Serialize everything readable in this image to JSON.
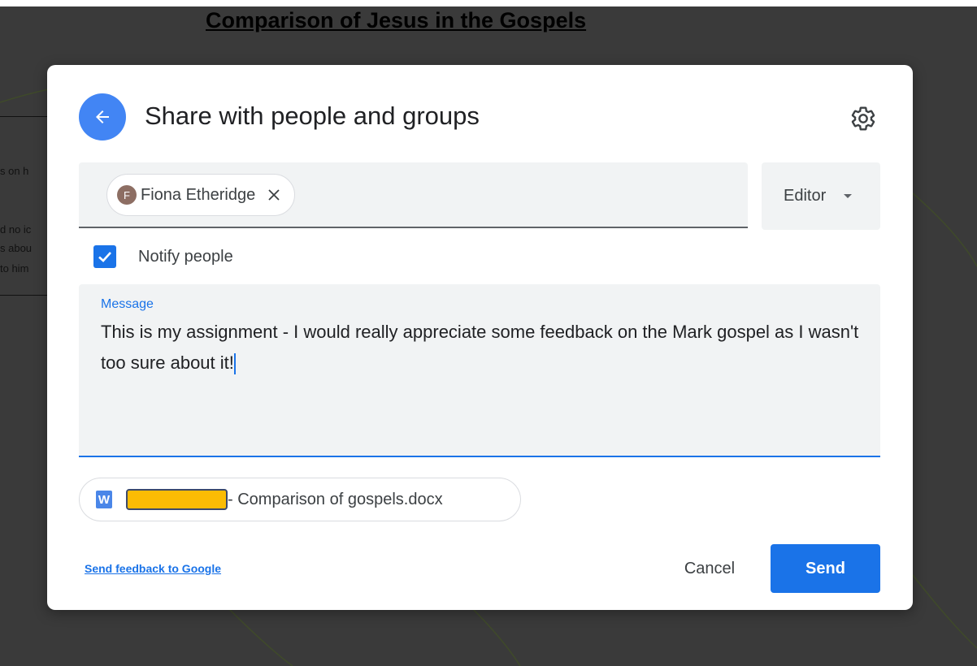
{
  "background_document": {
    "title": "Comparison of Jesus in the Gospels",
    "fragments": [
      "s on h",
      "d no ic",
      "s abou",
      "to him"
    ]
  },
  "dialog": {
    "title": "Share with people and groups",
    "back_icon": "arrow-left-icon",
    "settings_icon": "gear-icon",
    "recipient": {
      "initial": "F",
      "name": "Fiona Etheridge",
      "avatar_color": "#8d6e63"
    },
    "role": {
      "selected": "Editor"
    },
    "notify": {
      "label": "Notify people",
      "checked": true
    },
    "message": {
      "label": "Message",
      "value": "This is my assignment - I would really appreciate some feedback on the Mark gospel as I wasn't too sure about it!"
    },
    "attachment": {
      "icon_letter": "W",
      "name": "- Comparison of gospels.docx"
    },
    "footer": {
      "feedback_link": "Send feedback to Google",
      "cancel_label": "Cancel",
      "send_label": "Send"
    }
  },
  "colors": {
    "accent": "#1a73e8",
    "back_button": "#4285f4",
    "redaction": "#fbbc04",
    "backdrop": "#3a3a3a"
  }
}
